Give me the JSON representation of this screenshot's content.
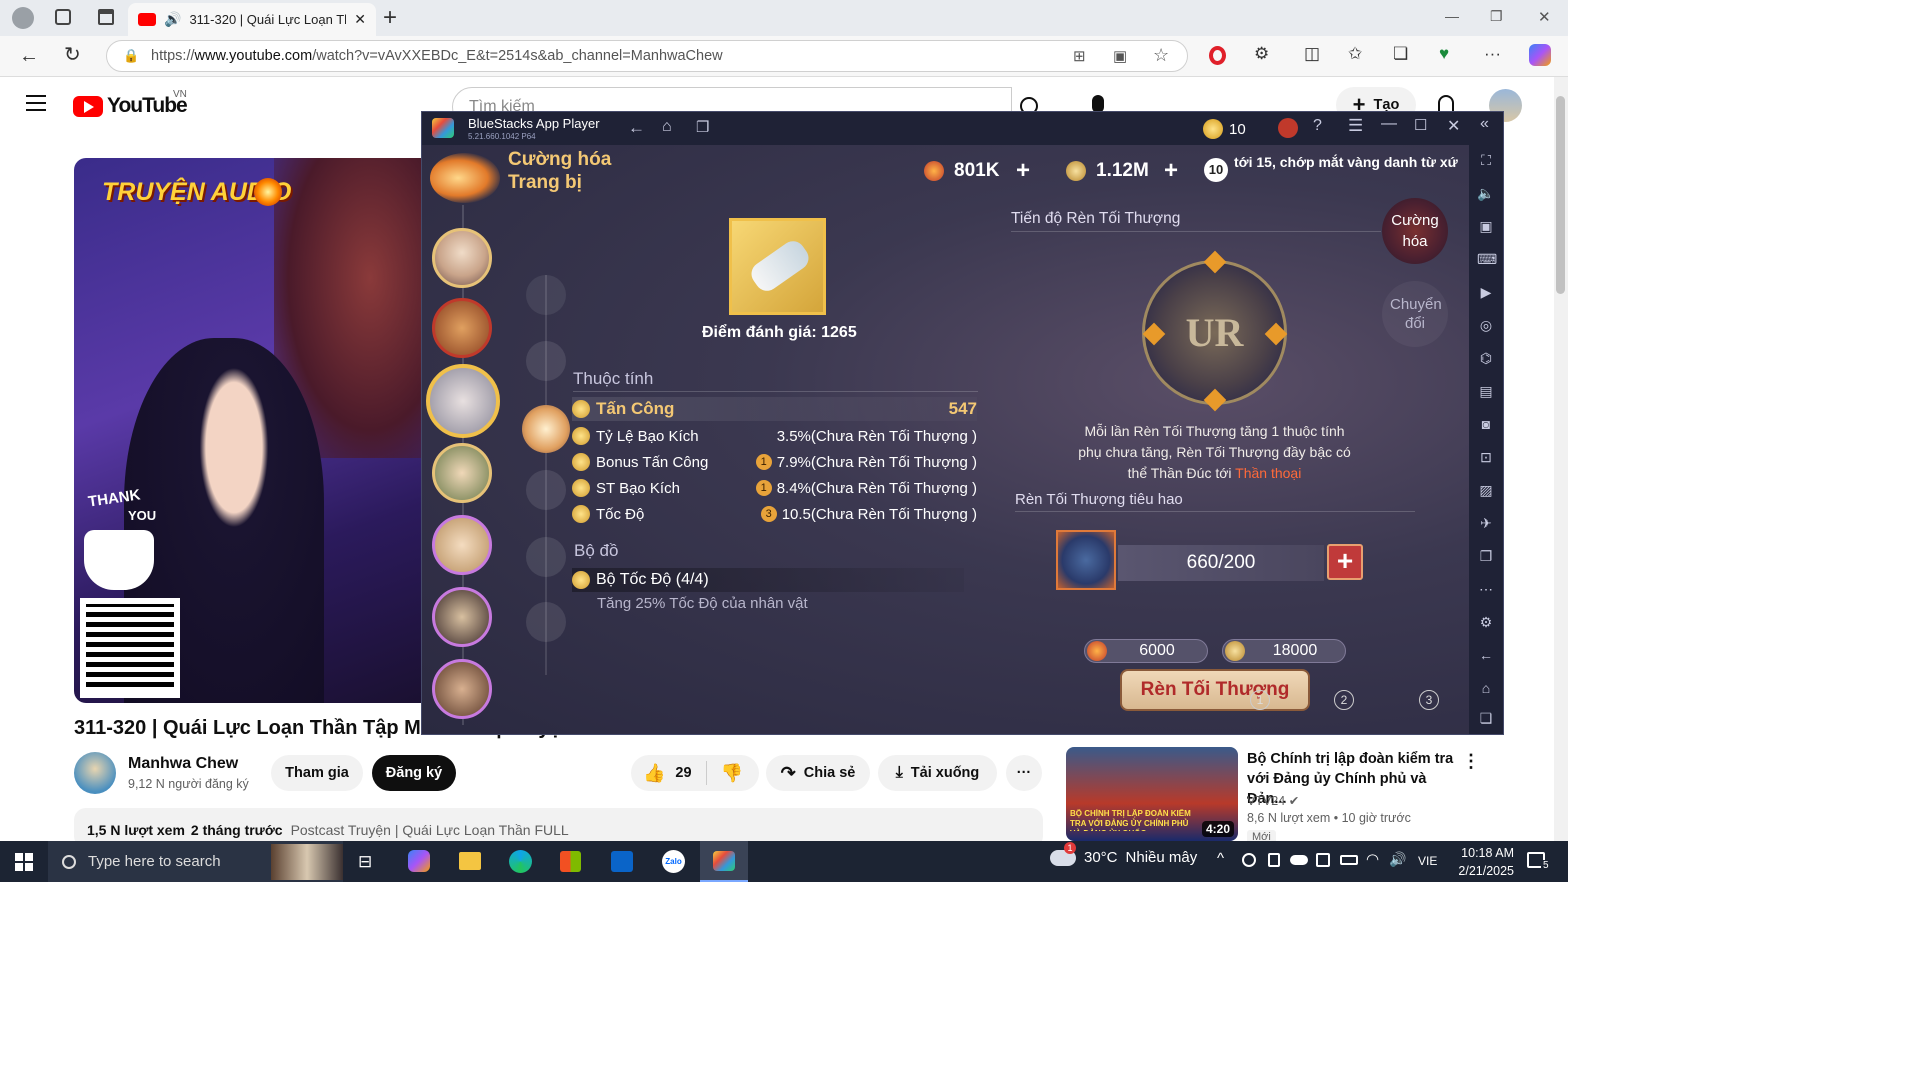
{
  "browser": {
    "tab_title": "311-320 | Quái Lực Loạn Thầ",
    "new_tab": "+",
    "url_prefix": "https://",
    "url_domain": "www.youtube.com",
    "url_path": "/watch?v=vAvXXEBDc_E&t=2514s&ab_channel=ManhwaChew",
    "window_controls": [
      "—",
      "❐",
      "✕"
    ]
  },
  "youtube": {
    "logo_text": "YouTube",
    "region": "VN",
    "search_placeholder": "Tìm kiếm",
    "create_label": "Tạo",
    "thumb_banner": "TRUYỆN AUDIO",
    "thumb_thank": "THANK",
    "thumb_you": "YOU",
    "video_title": "311-320 | Quái Lực Loạn Thần Tập Mới Nhất | Truyện Audio",
    "channel_name": "Manhwa Chew",
    "subscribers": "9,12 N người đăng ký",
    "join_label": "Tham gia",
    "subscribe_label": "Đăng ký",
    "likes": "29",
    "share_label": "Chia sẻ",
    "download_label": "Tải xuống",
    "more_label": "···",
    "views": "1,5 N lượt xem",
    "posted": "2 tháng trước",
    "playlist_link": "Postcast Truyện | Quái Lực Loạn Thần FULL",
    "rec": {
      "title": "Bộ Chính trị lập đoàn kiểm tra với Đảng ủy Chính phủ và Đản...",
      "channel": "VTV24",
      "views": "8,6 N lượt xem",
      "age": "10 giờ trước",
      "badge": "Mới",
      "duration": "4:20",
      "thumb_caption": "BỘ CHÍNH TRỊ LẬP ĐOÀN KIỂM TRA VỚI ĐẢNG ỦY CHÍNH PHỦ VÀ ĐẢNG ỦY QUỐC"
    }
  },
  "bluestacks": {
    "app_name": "BlueStacks App Player",
    "version": "5.21.660.1042  P64",
    "coins": "10",
    "game": {
      "screen_title_1": "Cường hóa",
      "screen_title_2": "Trang bị",
      "res1": "801K",
      "res2": "1.12M",
      "badge_level": "10",
      "marquee": "tới 15, chớp mắt vàng danh từ xứ!",
      "item_score": "Điểm đánh giá: 1265",
      "attr_header": "Thuộc tính",
      "stats": [
        {
          "name": "Tấn Công",
          "value": "547",
          "prefix": ""
        },
        {
          "name": "Tỷ Lệ Bạo Kích",
          "value": "3.5%(Chưa Rèn Tối Thượng )",
          "prefix": ""
        },
        {
          "name": "Bonus Tấn Công",
          "value": "7.9%(Chưa Rèn Tối Thượng )",
          "prefix": "1"
        },
        {
          "name": "ST Bạo Kích",
          "value": "8.4%(Chưa Rèn Tối Thượng )",
          "prefix": "1"
        },
        {
          "name": "Tốc Độ",
          "value": "10.5(Chưa Rèn Tối Thượng )",
          "prefix": "3"
        }
      ],
      "set_header": "Bộ đồ",
      "set_name": "Bộ Tốc Độ  (4/4)",
      "set_desc": "Tăng 25% Tốc Độ của nhân vật",
      "progress_title": "Tiến độ Rèn Tối Thượng",
      "rank": "UR",
      "tab_enhance": "Cường hóa",
      "tab_convert": "Chuyển đổi",
      "info_line1": "Mỗi lần Rèn Tối Thượng tăng 1 thuộc tính",
      "info_line2": "phụ chưa tăng, Rèn Tối Thượng đầy bậc có",
      "info_line3a": "thể Thần Đúc tới ",
      "info_line3b": "Thần thoại",
      "cost_title": "Rèn Tối Thượng tiêu hao",
      "material_count": "660/200",
      "cost1": "6000",
      "cost2": "18000",
      "forge_button": "Rèn Tối Thượng",
      "step1": "1",
      "step2": "2",
      "step3": "3"
    }
  },
  "taskbar": {
    "search_placeholder": "Type here to search",
    "weather_temp": "30°C",
    "weather_desc": "Nhiều mây",
    "weather_alert": "1",
    "lang": "VIE",
    "time": "10:18 AM",
    "date": "2/21/2025",
    "notif_count": "5"
  }
}
